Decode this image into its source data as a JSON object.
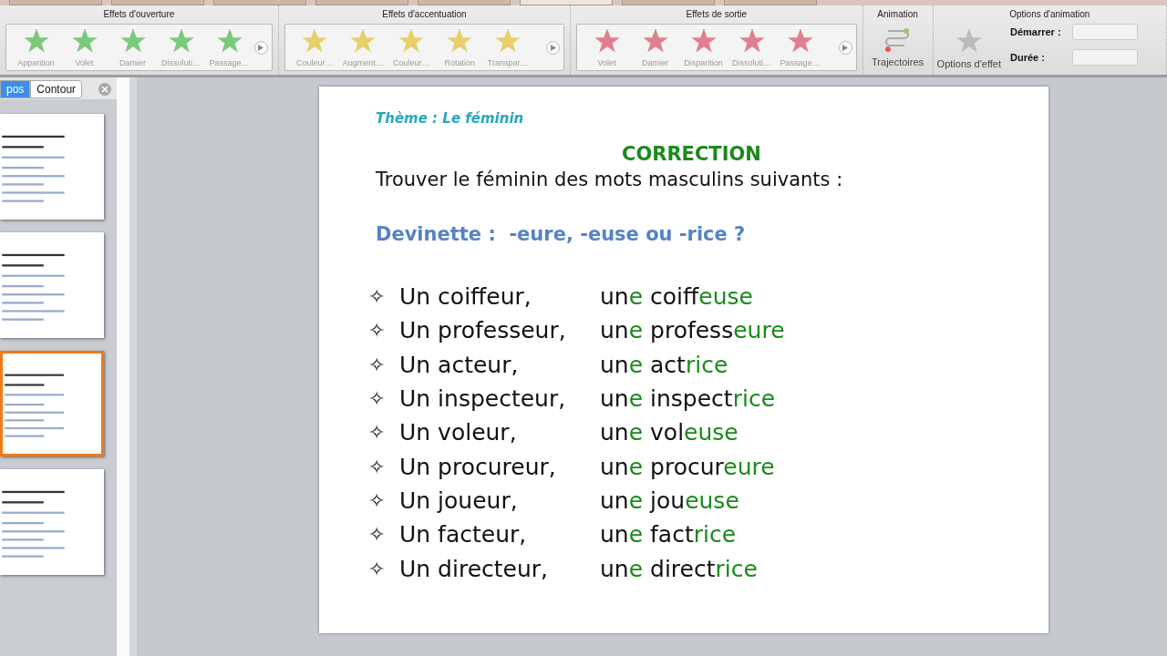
{
  "menu_tabs": [
    {
      "selected": false
    },
    {
      "selected": false
    },
    {
      "selected": false
    },
    {
      "selected": false
    },
    {
      "selected": false
    },
    {
      "selected": true
    },
    {
      "selected": false
    },
    {
      "selected": false
    }
  ],
  "ribbon": {
    "groups": [
      {
        "kind": "gallery",
        "title": "Effets d'ouverture",
        "color": "#7cc97c",
        "items": [
          "Apparition",
          "Volet",
          "Damier",
          "Dissoluti…",
          "Passage…"
        ]
      },
      {
        "kind": "gallery",
        "title": "Effets d'accentuation",
        "color": "#e8cf6a",
        "items": [
          "Couleur…",
          "Augment…",
          "Couleur…",
          "Rotation",
          "Transpar…"
        ]
      },
      {
        "kind": "gallery",
        "title": "Effets de sortie",
        "color": "#e0808c",
        "items": [
          "Volet",
          "Damier",
          "Disparition",
          "Dissoluti…",
          "Passage…"
        ]
      },
      {
        "kind": "paths",
        "title": "Animation",
        "button": "Trajectoires"
      },
      {
        "kind": "options",
        "title": "Options d'animation",
        "button": "Options d'effet",
        "start_label": "Démarrer :",
        "duration_label": "Durée :"
      }
    ]
  },
  "side_panel": {
    "tabs": [
      {
        "label": "pos",
        "selected": true
      },
      {
        "label": "Contour",
        "selected": false
      }
    ],
    "slides": [
      {
        "selected": false
      },
      {
        "selected": false
      },
      {
        "selected": true
      },
      {
        "selected": false
      }
    ]
  },
  "slide": {
    "theme": "Thème : Le féminin",
    "heading": "CORRECTION",
    "instruction": "Trouver le féminin des mots masculins suivants :",
    "hint": "Devinette :  -eure, -euse ou -rice ?",
    "rows": [
      {
        "bullet": "✧",
        "masculine": "Un coiffeur,",
        "article": "un",
        "article_end": "e",
        "stem": "coiff",
        "ending": "euse"
      },
      {
        "bullet": "✧",
        "masculine": "Un professeur,",
        "article": "un",
        "article_end": "e",
        "stem": "profess",
        "ending": "eure"
      },
      {
        "bullet": "✧",
        "masculine": "Un acteur,",
        "article": "un",
        "article_end": "e",
        "stem": "act",
        "ending": "rice"
      },
      {
        "bullet": "✧",
        "masculine": "Un inspecteur,",
        "article": "un",
        "article_end": "e",
        "stem": "inspect",
        "ending": "rice"
      },
      {
        "bullet": "✧",
        "masculine": "Un voleur,",
        "article": "un",
        "article_end": "e",
        "stem": "vol",
        "ending": "euse"
      },
      {
        "bullet": "✧",
        "masculine": "Un procureur,",
        "article": "un",
        "article_end": "e",
        "stem": "procur",
        "ending": "eure"
      },
      {
        "bullet": "✧",
        "masculine": "Un joueur,",
        "article": "un",
        "article_end": "e",
        "stem": "jou",
        "ending": "euse"
      },
      {
        "bullet": "✧",
        "masculine": "Un facteur,",
        "article": "un",
        "article_end": "e",
        "stem": "fact",
        "ending": "rice"
      },
      {
        "bullet": "✧",
        "masculine": "Un directeur,",
        "article": "un",
        "article_end": "e",
        "stem": "direct",
        "ending": "rice"
      }
    ]
  }
}
